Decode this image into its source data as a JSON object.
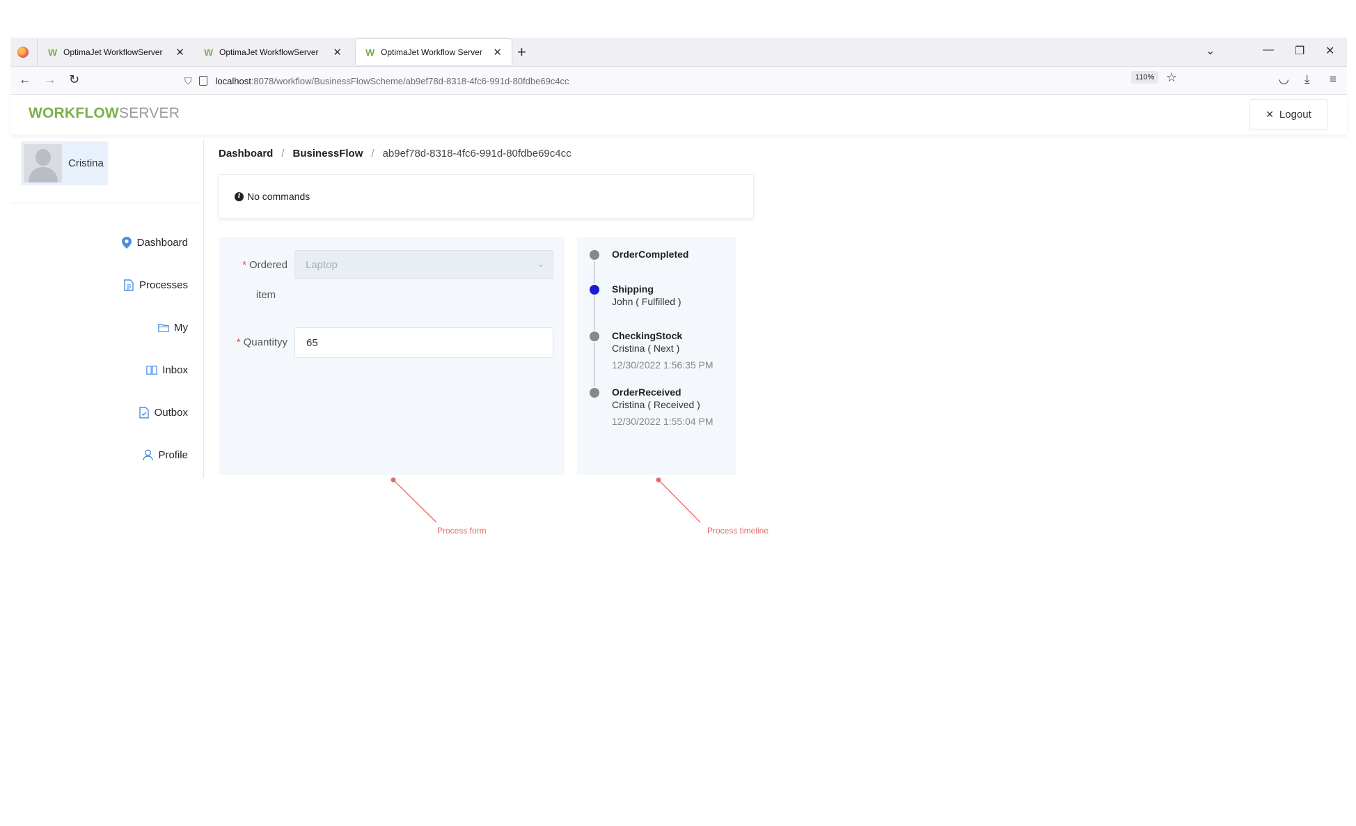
{
  "browser": {
    "tabs": [
      {
        "title": "OptimaJet WorkflowServer",
        "active": false
      },
      {
        "title": "OptimaJet WorkflowServer",
        "active": false
      },
      {
        "title": "OptimaJet Workflow Server",
        "active": true
      }
    ],
    "url_host": "localhost",
    "url_rest": ":8078/workflow/BusinessFlowScheme/ab9ef78d-8318-4fc6-991d-80fdbe69c4cc",
    "zoom": "110%"
  },
  "header": {
    "logo_part1": "WORKFLOW",
    "logo_part2": "SERVER",
    "logout_label": "Logout"
  },
  "sidebar": {
    "user_name": "Cristina",
    "items": [
      {
        "label": "Dashboard",
        "icon": "location-pin-icon"
      },
      {
        "label": "Processes",
        "icon": "document-icon"
      },
      {
        "label": "My",
        "icon": "folder-icon"
      },
      {
        "label": "Inbox",
        "icon": "book-icon"
      },
      {
        "label": "Outbox",
        "icon": "file-check-icon"
      },
      {
        "label": "Profile",
        "icon": "user-icon"
      }
    ]
  },
  "breadcrumb": {
    "items": [
      "Dashboard",
      "BusinessFlow"
    ],
    "current": "ab9ef78d-8318-4fc6-991d-80fdbe69c4cc"
  },
  "commands": {
    "text": "No commands"
  },
  "form": {
    "ordered_item_label_1": "Ordered",
    "ordered_item_label_2": "item",
    "ordered_item_value": "Laptop",
    "quantity_label": "Quantityy",
    "quantity_value": "65"
  },
  "timeline": [
    {
      "title": "OrderCompleted",
      "actor": "",
      "date": "",
      "current": false
    },
    {
      "title": "Shipping",
      "actor": "John ( Fulfilled )",
      "date": "",
      "current": true
    },
    {
      "title": "CheckingStock",
      "actor": "Cristina ( Next )",
      "date": "12/30/2022 1:56:35 PM",
      "current": false
    },
    {
      "title": "OrderReceived",
      "actor": "Cristina ( Received )",
      "date": "12/30/2022 1:55:04 PM",
      "current": false
    }
  ],
  "annotations": {
    "form": "Process form",
    "timeline": "Process timeline",
    "color": "#e86a6a"
  }
}
